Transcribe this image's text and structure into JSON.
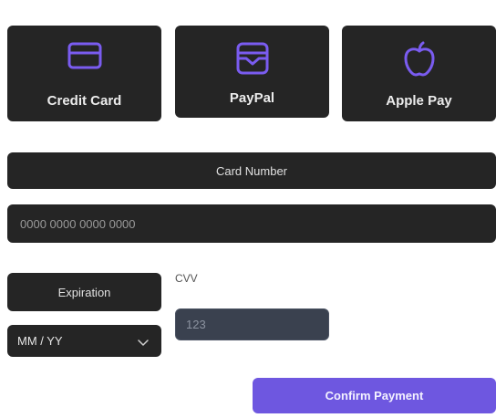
{
  "payment_methods": [
    {
      "label": "Credit Card",
      "icon": "credit-card-icon"
    },
    {
      "label": "PayPal",
      "icon": "wallet-icon"
    },
    {
      "label": "Apple Pay",
      "icon": "apple-icon"
    }
  ],
  "card_number": {
    "label": "Card Number",
    "placeholder": "0000 0000 0000 0000"
  },
  "expiration": {
    "label": "Expiration",
    "selected": "MM / YY"
  },
  "cvv": {
    "label": "CVV",
    "placeholder": "123"
  },
  "confirm_label": "Confirm Payment",
  "colors": {
    "accent": "#6e57e0",
    "icon": "#7a5cf0",
    "panel": "#252525"
  }
}
